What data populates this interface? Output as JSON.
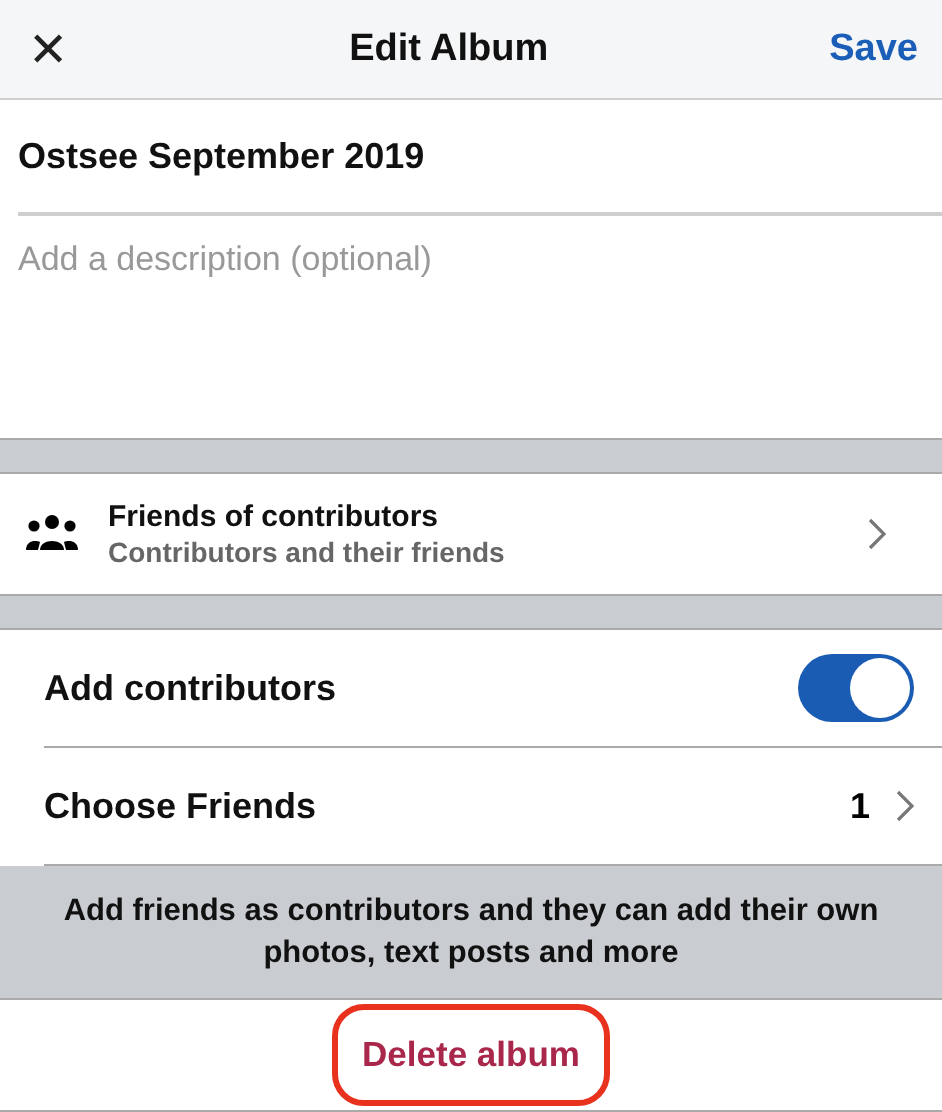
{
  "header": {
    "close_glyph": "✕",
    "title": "Edit Album",
    "action": "Save"
  },
  "album": {
    "name": "Ostsee September 2019",
    "description_placeholder": "Add a description (optional)"
  },
  "privacy": {
    "title": "Friends of contributors",
    "subtitle": "Contributors and their friends"
  },
  "settings": [
    {
      "kind": "toggle",
      "label": "Add contributors",
      "on": true
    },
    {
      "kind": "link",
      "label": "Choose Friends",
      "value": "1"
    }
  ],
  "note": "Add friends as contributors and they can add their own photos, text posts and more",
  "delete": {
    "label": "Delete album",
    "highlighted": true
  }
}
